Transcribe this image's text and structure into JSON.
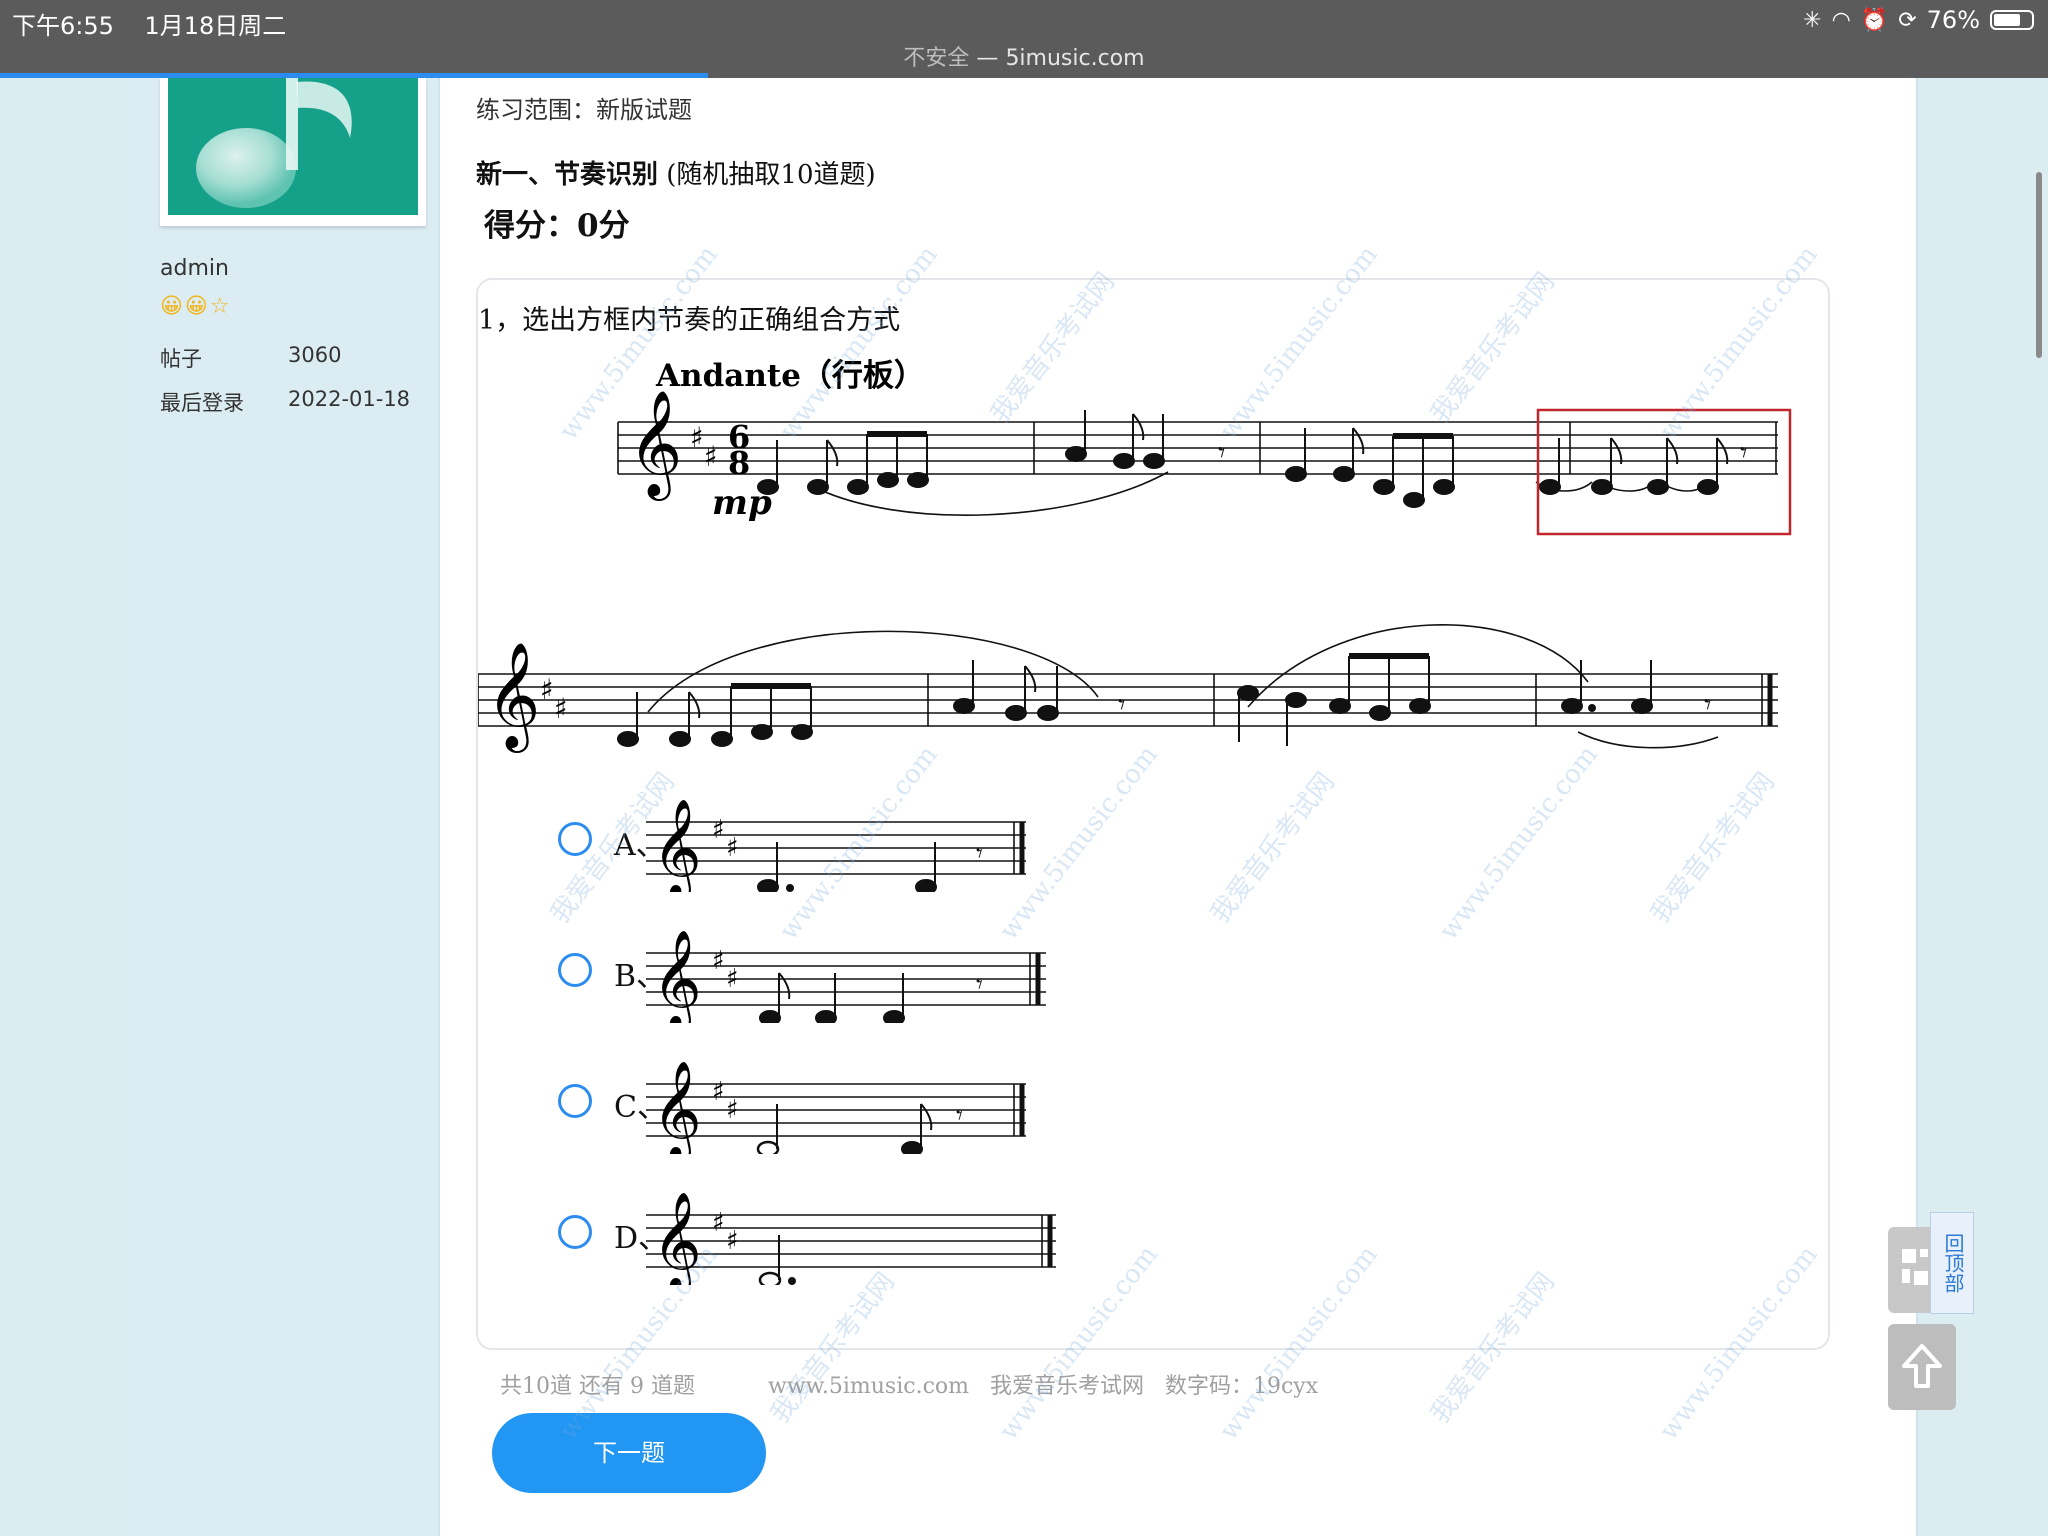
{
  "status": {
    "time": "下午6:55",
    "date": "1月18日周二",
    "battery": "76%",
    "battery_level": 0.76
  },
  "browser": {
    "insecure_label": "不安全",
    "separator": " — ",
    "domain": "5imusic.com"
  },
  "sidebar": {
    "username": "admin",
    "rank_icons": "😀😀☆",
    "posts_label": "帖子",
    "posts_value": "3060",
    "last_login_label": "最后登录",
    "last_login_value": "2022-01-18"
  },
  "main": {
    "range": "练习范围：新版试题",
    "section_bold": "新一、节奏识别",
    "section_rest": " (随机抽取10道题)",
    "score": "得分：0分"
  },
  "question": {
    "text": "1，选出方框内节奏的正确组合方式",
    "tempo": "Andante（行板）",
    "time_sig_top": "6",
    "time_sig_bottom": "8",
    "dynamic": "mp",
    "options": [
      {
        "label": "A、"
      },
      {
        "label": "B、"
      },
      {
        "label": "C、"
      },
      {
        "label": "D、"
      }
    ]
  },
  "footer": {
    "count": "共10道  还有 9 道题",
    "site": "www.5imusic.com",
    "name": "我爱音乐考试网",
    "code": "数字码：19cyx"
  },
  "next_button": "下一题",
  "widgets": {
    "back_to_top": "回顶部"
  },
  "colors": {
    "accent": "#2196f3",
    "highlight_box": "#c0272d",
    "avatar_bg": "#15a089"
  }
}
